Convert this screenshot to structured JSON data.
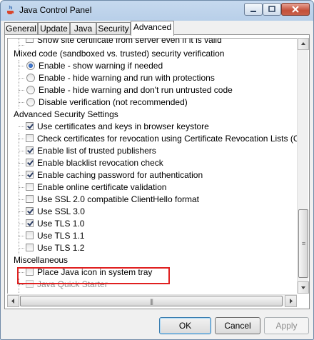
{
  "window": {
    "title": "Java Control Panel"
  },
  "tabs": [
    {
      "label": "General"
    },
    {
      "label": "Update"
    },
    {
      "label": "Java"
    },
    {
      "label": "Security"
    },
    {
      "label": "Advanced"
    }
  ],
  "settings": {
    "partial_top": {
      "label": "Show site certificate from server even if it is valid",
      "checked": false
    },
    "mixed_code": {
      "heading": "Mixed code (sandboxed vs. trusted) security verification",
      "options": [
        {
          "label": "Enable - show warning if needed",
          "selected": true
        },
        {
          "label": "Enable - hide warning and run with protections",
          "selected": false
        },
        {
          "label": "Enable - hide warning and don't run untrusted code",
          "selected": false
        },
        {
          "label": "Disable verification (not recommended)",
          "selected": false
        }
      ]
    },
    "advanced_security": {
      "heading": "Advanced Security Settings",
      "items": [
        {
          "label": "Use certificates and keys in browser keystore",
          "checked": true
        },
        {
          "label": "Check certificates for revocation using Certificate Revocation Lists (CRLs)",
          "checked": false
        },
        {
          "label": "Enable list of trusted publishers",
          "checked": true
        },
        {
          "label": "Enable blacklist revocation check",
          "checked": true
        },
        {
          "label": "Enable caching password for authentication",
          "checked": true
        },
        {
          "label": "Enable online certificate validation",
          "checked": false
        },
        {
          "label": "Use SSL 2.0 compatible ClientHello format",
          "checked": false
        },
        {
          "label": "Use SSL 3.0",
          "checked": true
        },
        {
          "label": "Use TLS 1.0",
          "checked": true
        },
        {
          "label": "Use TLS 1.1",
          "checked": false
        },
        {
          "label": "Use TLS 1.2",
          "checked": false
        }
      ]
    },
    "misc": {
      "heading": "Miscellaneous",
      "items": [
        {
          "label": "Place Java icon in system tray",
          "checked": false,
          "disabled": false
        },
        {
          "label": "Java Quick Starter",
          "checked": false,
          "disabled": true
        }
      ]
    }
  },
  "buttons": {
    "ok": "OK",
    "cancel": "Cancel",
    "apply": "Apply"
  },
  "colors": {
    "highlight_border": "#e02020",
    "title_bar": "#c6d9ee",
    "ok_focus": "#3c7fb1"
  }
}
